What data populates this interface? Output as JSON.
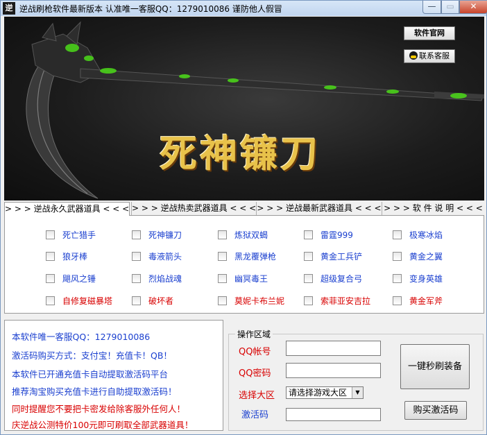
{
  "window": {
    "title": "逆战刷枪软件最新版本  认准唯一客服QQ：1279010086 谨防他人假冒",
    "icon_label": "逆",
    "min_glyph": "—",
    "max_glyph": "▭",
    "close_glyph": "✕"
  },
  "banner": {
    "title": "死神镰刀",
    "official_button": "软件官网",
    "contact_button": "联系客服"
  },
  "tabs": [
    {
      "label": "> > > 逆战永久武器道具 < < <",
      "active": true
    },
    {
      "label": "> > > 逆战热卖武器道具 < < <",
      "active": false
    },
    {
      "label": "> > > 逆战最新武器道具 < < <",
      "active": false
    },
    {
      "label": "> > > 软 件 说 明 < < <",
      "active": false
    }
  ],
  "items": [
    {
      "label": "死亡猎手",
      "color": "#1a3fcf"
    },
    {
      "label": "死神镰刀",
      "color": "#1a3fcf"
    },
    {
      "label": "炼狱双蝎",
      "color": "#1a3fcf"
    },
    {
      "label": "雷霆999",
      "color": "#1a3fcf"
    },
    {
      "label": "极寒冰焰",
      "color": "#1a3fcf"
    },
    {
      "label": "狼牙棒",
      "color": "#1a3fcf"
    },
    {
      "label": "毒液箭头",
      "color": "#1a3fcf"
    },
    {
      "label": "黑龙覆弹枪",
      "color": "#1a3fcf"
    },
    {
      "label": "黄金工兵铲",
      "color": "#1a3fcf"
    },
    {
      "label": "黄金之翼",
      "color": "#1a3fcf"
    },
    {
      "label": "飓风之锤",
      "color": "#1a3fcf"
    },
    {
      "label": "烈焰战魂",
      "color": "#1a3fcf"
    },
    {
      "label": "幽冥毒王",
      "color": "#1a3fcf"
    },
    {
      "label": "超级复合弓",
      "color": "#1a3fcf"
    },
    {
      "label": "变身英雄",
      "color": "#1a3fcf"
    },
    {
      "label": "自修复磁暴塔",
      "color": "#d80000"
    },
    {
      "label": "破坏者",
      "color": "#d80000"
    },
    {
      "label": "莫妮卡布兰妮",
      "color": "#d80000"
    },
    {
      "label": "索菲亚安吉拉",
      "color": "#d80000"
    },
    {
      "label": "黄金军斧",
      "color": "#d80000"
    }
  ],
  "info_lines": [
    {
      "text": "本软件唯一客服QQ：1279010086",
      "color": "#1a3fcf"
    },
    {
      "text": "激活码购买方式：支付宝！充值卡！QB！",
      "color": "#1a3fcf"
    },
    {
      "text": "本软件已开通充值卡自动提取激活码平台",
      "color": "#1a3fcf"
    },
    {
      "text": "推荐淘宝购买充值卡进行自助提取激活码！",
      "color": "#1a3fcf"
    },
    {
      "text": "同时提醒您不要把卡密发给除客服外任何人！",
      "color": "#d80000"
    },
    {
      "text": "庆逆战公测特价100元即可刷取全部武器道具！",
      "color": "#d80000"
    }
  ],
  "operation": {
    "group_title": "操作区域",
    "qq_account_label": "QQ帐号",
    "qq_password_label": "QQ密码",
    "region_label": "选择大区",
    "region_value": "请选择游戏大区",
    "activation_label": "激活码",
    "onekey_button": "一键秒刷装备",
    "buy_button": "购买激活码",
    "activation_label_color": "#1a3fcf"
  },
  "colors": {
    "blue_text": "#1a3fcf",
    "red_text": "#d80000",
    "banner_title": "#e8c24a",
    "weapon_glow": "#4ad11a"
  }
}
